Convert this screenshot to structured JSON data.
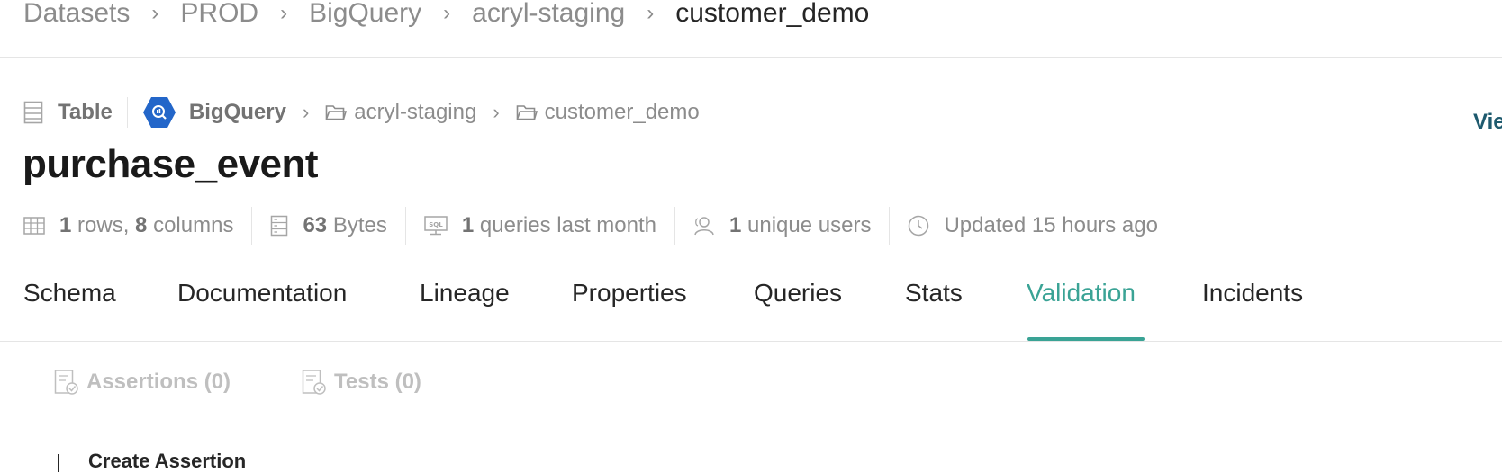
{
  "breadcrumb": {
    "items": [
      "Datasets",
      "PROD",
      "BigQuery",
      "acryl-staging"
    ],
    "current": "customer_demo",
    "separator": "›"
  },
  "entity": {
    "type_label": "Table",
    "platform": "BigQuery",
    "path": [
      "acryl-staging",
      "customer_demo"
    ],
    "path_separator": "›",
    "name": "purchase_event",
    "view_link": "Vie"
  },
  "stats": {
    "rows_value": "1",
    "rows_text": " rows, ",
    "columns_value": "8",
    "columns_text": " columns",
    "size_value": "63",
    "size_text": " Bytes",
    "queries_value": "1",
    "queries_text": " queries last month",
    "users_value": "1",
    "users_text": " unique users",
    "updated_text": "Updated 15 hours ago"
  },
  "tabs": [
    {
      "label": "Schema",
      "active": false
    },
    {
      "label": "Documentation",
      "active": false
    },
    {
      "label": "Lineage",
      "active": false
    },
    {
      "label": "Properties",
      "active": false
    },
    {
      "label": "Queries",
      "active": false
    },
    {
      "label": "Stats",
      "active": false
    },
    {
      "label": "Validation",
      "active": true
    },
    {
      "label": "Incidents",
      "active": false
    }
  ],
  "subtabs": [
    {
      "label": "Assertions (0)"
    },
    {
      "label": "Tests (0)"
    }
  ],
  "create_assertion_label": "Create Assertion",
  "colors": {
    "accent": "#3aa395",
    "platform_blue": "#2366c9",
    "muted_text": "#8c8c8c",
    "link": "#1e5a6e"
  },
  "icons": {
    "table": "table-icon",
    "platform": "bigquery-logo-icon",
    "folder": "folder-icon",
    "grid": "grid-icon",
    "storage": "database-icon",
    "queries": "sql-monitor-icon",
    "users": "users-icon",
    "clock": "clock-icon",
    "assertions": "checklist-icon",
    "tests": "test-icon"
  }
}
